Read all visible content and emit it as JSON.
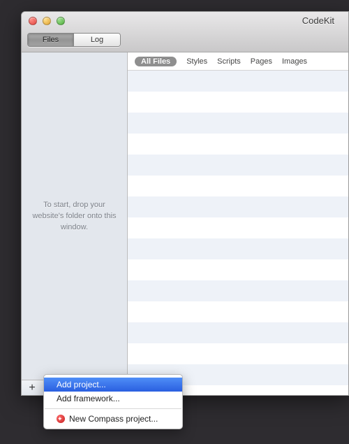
{
  "app_title": "CodeKit",
  "traffic": {
    "close": "close",
    "min": "minimize",
    "zoom": "zoom"
  },
  "tabs": {
    "files": "Files",
    "log": "Log",
    "active": "files"
  },
  "filters": {
    "items": [
      "All Files",
      "Styles",
      "Scripts",
      "Pages",
      "Images"
    ],
    "active_index": 0
  },
  "sidebar_hint": "To start, drop your website's folder onto this window.",
  "add_button_label": "+",
  "context_menu": {
    "add_project": "Add project...",
    "add_framework": "Add framework...",
    "new_compass": "New Compass project...",
    "highlighted": "add_project"
  },
  "file_rows": 15
}
